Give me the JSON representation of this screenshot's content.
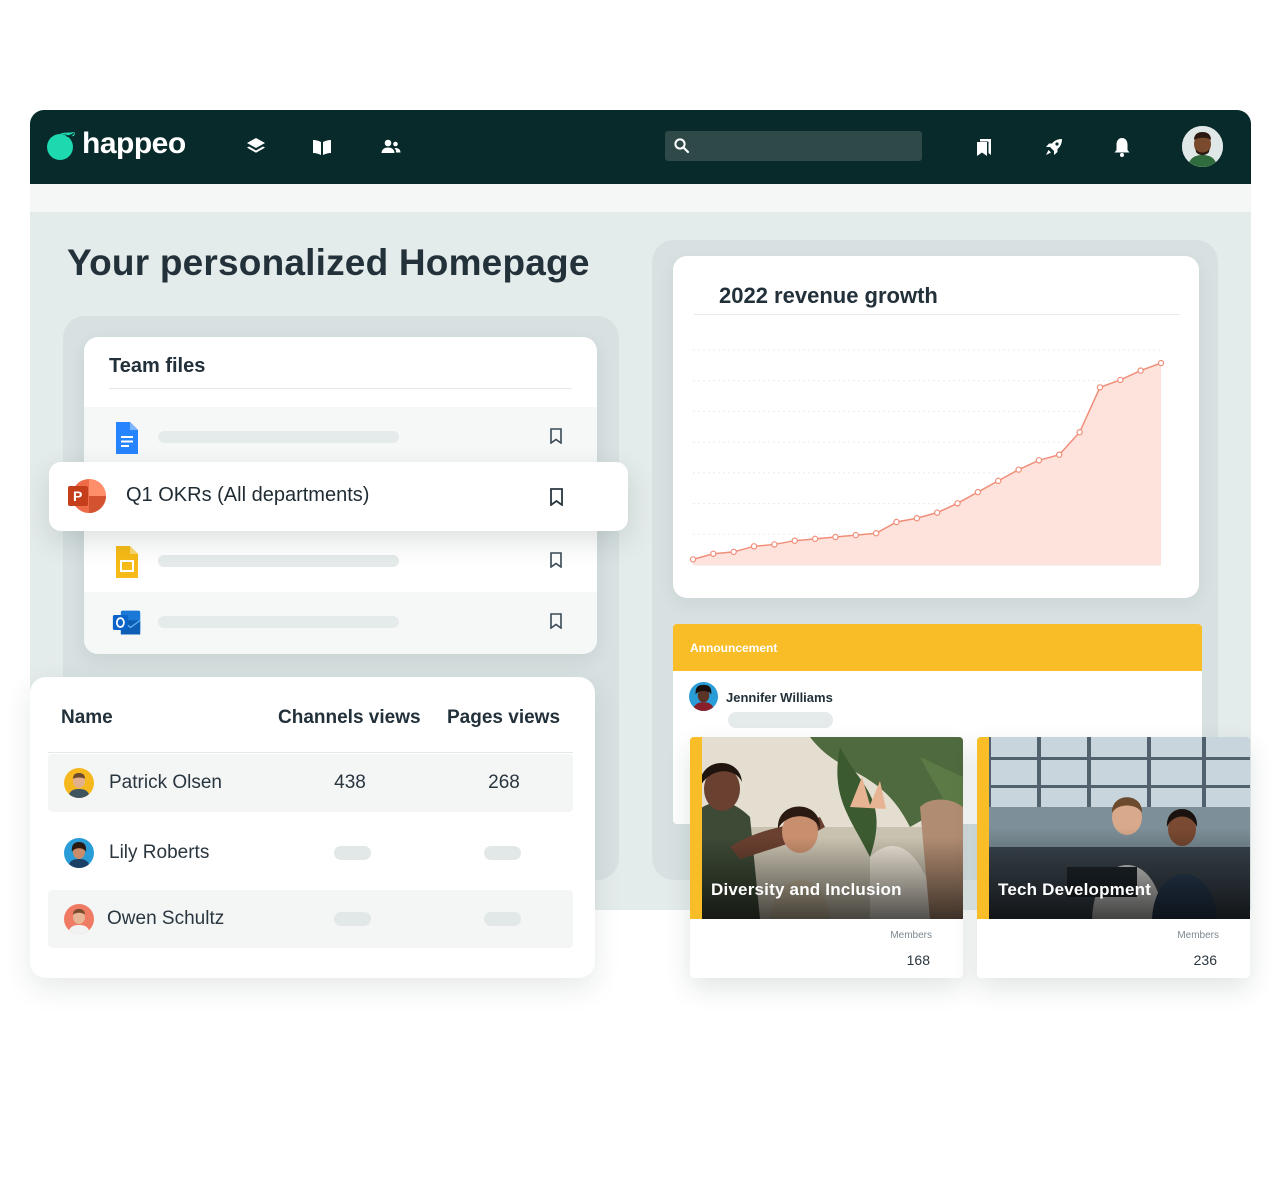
{
  "app": {
    "name": "happeo",
    "brand_color": "#082a2a",
    "accent_color": "#1ed9b0"
  },
  "topbar": {
    "nav_icons": [
      "layers-icon",
      "book-icon",
      "people-icon"
    ],
    "search": {
      "placeholder": "",
      "value": ""
    },
    "right_icons": [
      "bookmarks-icon",
      "rocket-icon",
      "bell-icon"
    ]
  },
  "page": {
    "title": "Your personalized Homepage"
  },
  "team_files": {
    "title": "Team files",
    "files": [
      {
        "icon": "google-docs-icon",
        "label": ""
      },
      {
        "icon": "powerpoint-icon",
        "label": "Q1 OKRs (All departments)"
      },
      {
        "icon": "google-slides-icon",
        "label": ""
      },
      {
        "icon": "outlook-icon",
        "label": ""
      }
    ]
  },
  "views_table": {
    "columns": [
      "Name",
      "Channels views",
      "Pages views"
    ],
    "rows": [
      {
        "name": "Patrick Olsen",
        "channels_views": "438",
        "pages_views": "268"
      },
      {
        "name": "Lily Roberts",
        "channels_views": null,
        "pages_views": null
      },
      {
        "name": "Owen Schultz",
        "channels_views": null,
        "pages_views": null
      }
    ]
  },
  "chart": {
    "title": "2022 revenue growth"
  },
  "chart_data": {
    "type": "area",
    "title": "2022 revenue growth",
    "xlabel": "",
    "ylabel": "",
    "grid": true,
    "color": "#f08e7a",
    "fill": "#fde3dc",
    "x": [
      1,
      2,
      3,
      4,
      5,
      6,
      7,
      8,
      9,
      10,
      11,
      12,
      13,
      14,
      15,
      16,
      17,
      18,
      19,
      20,
      21,
      22,
      23,
      24
    ],
    "values": [
      3,
      6,
      7,
      10,
      11,
      13,
      14,
      15,
      16,
      17,
      23,
      25,
      28,
      33,
      39,
      45,
      51,
      56,
      59,
      71,
      95,
      99,
      104,
      108
    ],
    "ylim": [
      0,
      115
    ]
  },
  "announcement": {
    "label": "Announcement",
    "author": "Jennifer Williams",
    "color": "#f9bd28"
  },
  "channels": [
    {
      "title": "Diversity and Inclusion",
      "members_label": "Members",
      "members": "168"
    },
    {
      "title": "Tech Development",
      "members_label": "Members",
      "members": "236"
    }
  ]
}
